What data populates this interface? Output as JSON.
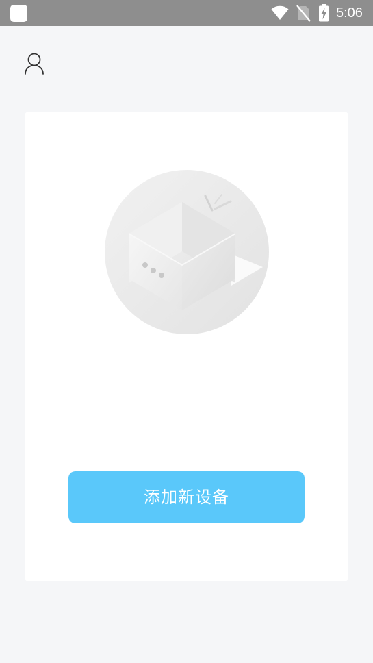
{
  "status_bar": {
    "time": "5:06",
    "icons": [
      "app-indicator-icon",
      "wifi-icon",
      "no-sim-icon",
      "battery-charging-icon"
    ]
  },
  "header": {
    "profile_icon": "person-outline-icon"
  },
  "empty_state": {
    "illustration": "empty-box-icon",
    "add_button_label": "添加新设备"
  },
  "colors": {
    "status_bar": "#8e8e8e",
    "background": "#f5f6f8",
    "card": "#ffffff",
    "accent": "#5ac8fa",
    "button_text": "#ffffff",
    "icon_stroke": "#333333"
  }
}
